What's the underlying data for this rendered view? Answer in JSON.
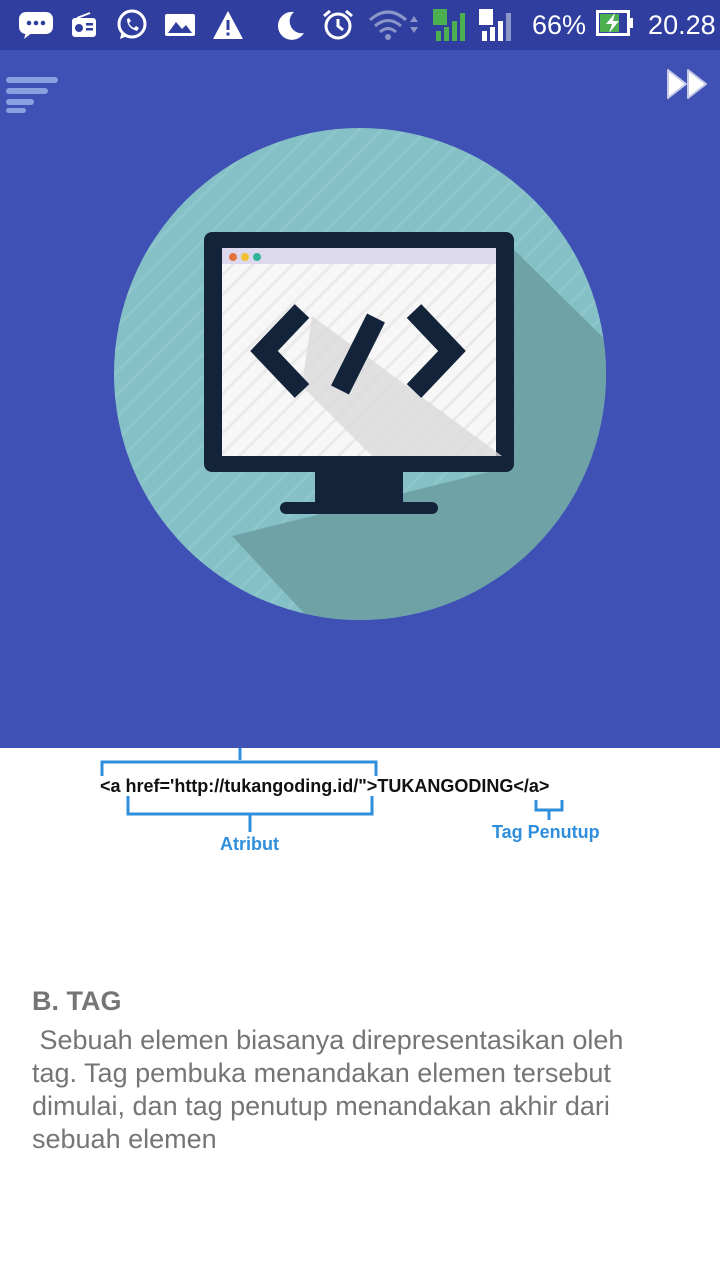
{
  "status_bar": {
    "battery_percent": "66%",
    "time": "20.28",
    "sim1_label": "1",
    "sim2_label": "2",
    "icons": [
      "messages-icon",
      "radio-icon",
      "whatsapp-icon",
      "gallery-icon",
      "warning-icon",
      "moon-icon",
      "alarm-icon",
      "wifi-icon",
      "signal-sim1-icon",
      "signal-sim2-icon",
      "battery-charging-icon"
    ]
  },
  "hero": {
    "background_color": "#3f51b5",
    "illustration": "monitor-code-icon",
    "menu_icon": "menu-lines-icon",
    "skip_icon": "fast-forward-icon"
  },
  "diagram": {
    "code": "<a href='http://tukangoding.id/\">TUKANGODING</a>",
    "attribute_label": "Atribut",
    "closing_tag_label": "Tag Penutup"
  },
  "section": {
    "heading": "B. TAG",
    "body": " Sebuah elemen biasanya direpresentasikan oleh\ntag. Tag pembuka menandakan elemen tersebut\ndimulai, dan tag penutup menandakan akhir dari\nsebuah elemen"
  }
}
